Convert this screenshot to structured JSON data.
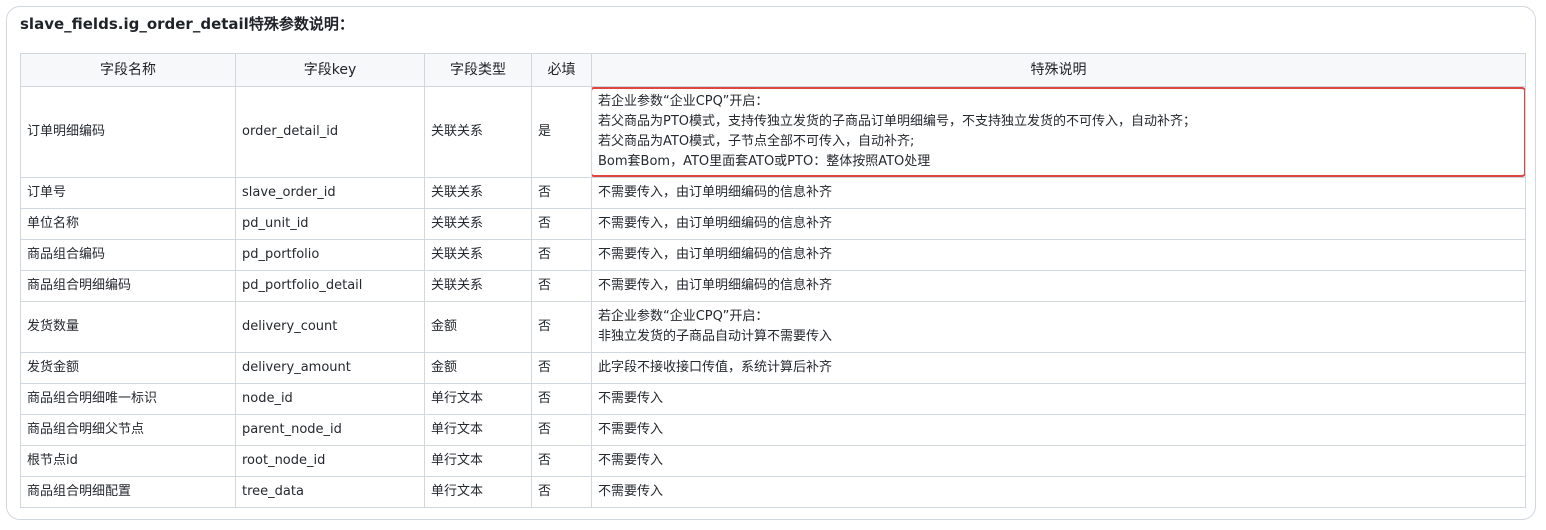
{
  "title": "slave_fields.ig_order_detail特殊参数说明：",
  "table": {
    "headers": [
      "字段名称",
      "字段key",
      "字段类型",
      "必填",
      "特殊说明"
    ],
    "rows": [
      {
        "name": "订单明细编码",
        "key": "order_detail_id",
        "type": "关联关系",
        "required": "是",
        "note": [
          "若企业参数“企业CPQ”开启：",
          "若父商品为PTO模式，支持传独立发货的子商品订单明细编号，不支持独立发货的不可传入，自动补齐；",
          "若父商品为ATO模式，子节点全部不可传入，自动补齐;",
          "Bom套Bom，ATO里面套ATO或PTO：整体按照ATO处理"
        ],
        "highlighted": true
      },
      {
        "name": "订单号",
        "key": "slave_order_id",
        "type": "关联关系",
        "required": "否",
        "note": [
          "不需要传入，由订单明细编码的信息补齐"
        ]
      },
      {
        "name": "单位名称",
        "key": "pd_unit_id",
        "type": "关联关系",
        "required": "否",
        "note": [
          "不需要传入，由订单明细编码的信息补齐"
        ]
      },
      {
        "name": "商品组合编码",
        "key": "pd_portfolio",
        "type": "关联关系",
        "required": "否",
        "note": [
          "不需要传入，由订单明细编码的信息补齐"
        ]
      },
      {
        "name": "商品组合明细编码",
        "key": "pd_portfolio_detail",
        "type": "关联关系",
        "required": "否",
        "note": [
          "不需要传入，由订单明细编码的信息补齐"
        ]
      },
      {
        "name": "发货数量",
        "key": "delivery_count",
        "type": "金额",
        "required": "否",
        "note": [
          "若企业参数“企业CPQ”开启：",
          "非独立发货的子商品自动计算不需要传入"
        ]
      },
      {
        "name": "发货金额",
        "key": "delivery_amount",
        "type": "金额",
        "required": "否",
        "note": [
          "此字段不接收接口传值，系统计算后补齐"
        ]
      },
      {
        "name": "商品组合明细唯一标识",
        "key": "node_id",
        "type": "单行文本",
        "required": "否",
        "note": [
          "不需要传入"
        ]
      },
      {
        "name": "商品组合明细父节点",
        "key": "parent_node_id",
        "type": "单行文本",
        "required": "否",
        "note": [
          "不需要传入"
        ]
      },
      {
        "name": "根节点id",
        "key": "root_node_id",
        "type": "单行文本",
        "required": "否",
        "note": [
          "不需要传入"
        ]
      },
      {
        "name": "商品组合明细配置",
        "key": "tree_data",
        "type": "单行文本",
        "required": "否",
        "note": [
          "不需要传入"
        ]
      }
    ]
  },
  "colors": {
    "highlight_border": "#e0443e",
    "header_bg": "#f6f8fa",
    "grid": "#d0d7de"
  }
}
